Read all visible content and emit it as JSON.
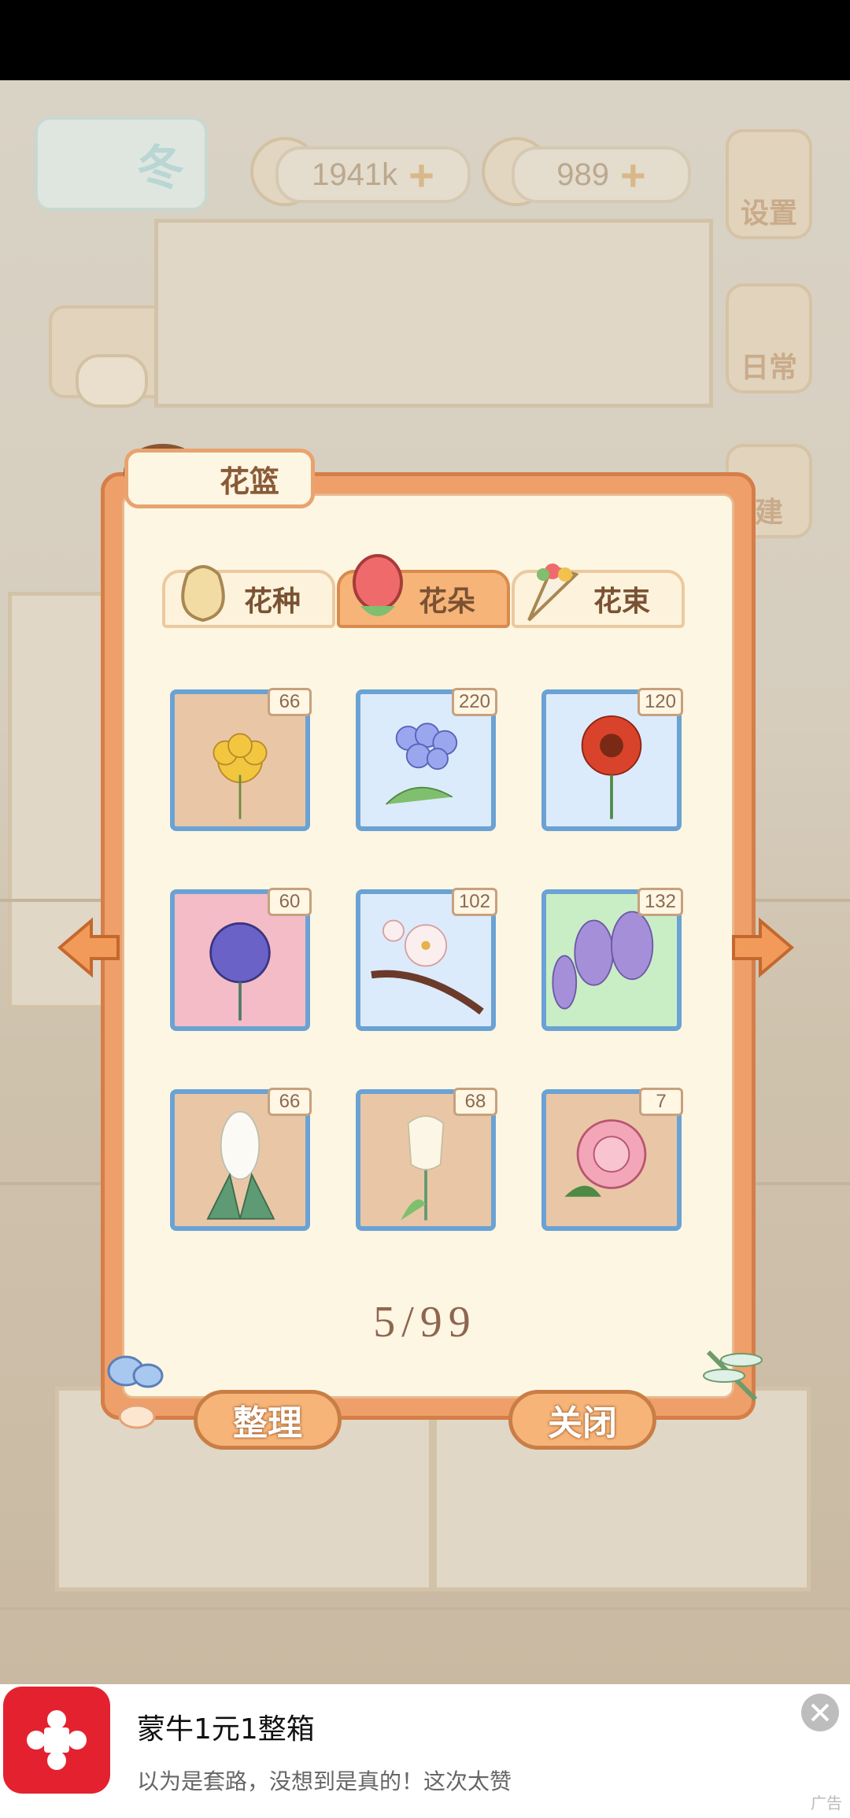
{
  "hud": {
    "season_label": "冬",
    "fish_amount": "1941k",
    "cheese_amount": "989",
    "settings_label": "设置",
    "daily_label": "日常",
    "build_label": "建"
  },
  "dialog": {
    "title": "花篮",
    "tabs": [
      {
        "label": "花种",
        "active": false
      },
      {
        "label": "花朵",
        "active": true
      },
      {
        "label": "花束",
        "active": false
      }
    ],
    "items": [
      {
        "name": "spider-lily",
        "count": "66",
        "bg": "#e9c7a6"
      },
      {
        "name": "blue-hydrangea",
        "count": "220",
        "bg": "#dcebfb"
      },
      {
        "name": "red-sunflower",
        "count": "120",
        "bg": "#dcebfb"
      },
      {
        "name": "globe-thistle",
        "count": "60",
        "bg": "#f3bcc7"
      },
      {
        "name": "plum-blossom",
        "count": "102",
        "bg": "#dcebfb"
      },
      {
        "name": "wisteria",
        "count": "132",
        "bg": "#c9eec6"
      },
      {
        "name": "hyacinth",
        "count": "66",
        "bg": "#e9c7a6"
      },
      {
        "name": "white-tulip",
        "count": "68",
        "bg": "#e9c7a6"
      },
      {
        "name": "peony",
        "count": "7",
        "bg": "#e9c7a6"
      }
    ],
    "capacity": "5/99",
    "sort_label": "整理",
    "close_label": "关闭"
  },
  "ad": {
    "title": "蒙牛1元1整箱",
    "description": "以为是套路，没想到是真的！这次太赞",
    "tag": "广告"
  },
  "colors": {
    "dialog_frame": "#ee9f6a",
    "dialog_bg": "#fdf6e3",
    "cell_border": "#6ba2d4",
    "button": "#f6b478",
    "ad_red": "#e4222f"
  }
}
